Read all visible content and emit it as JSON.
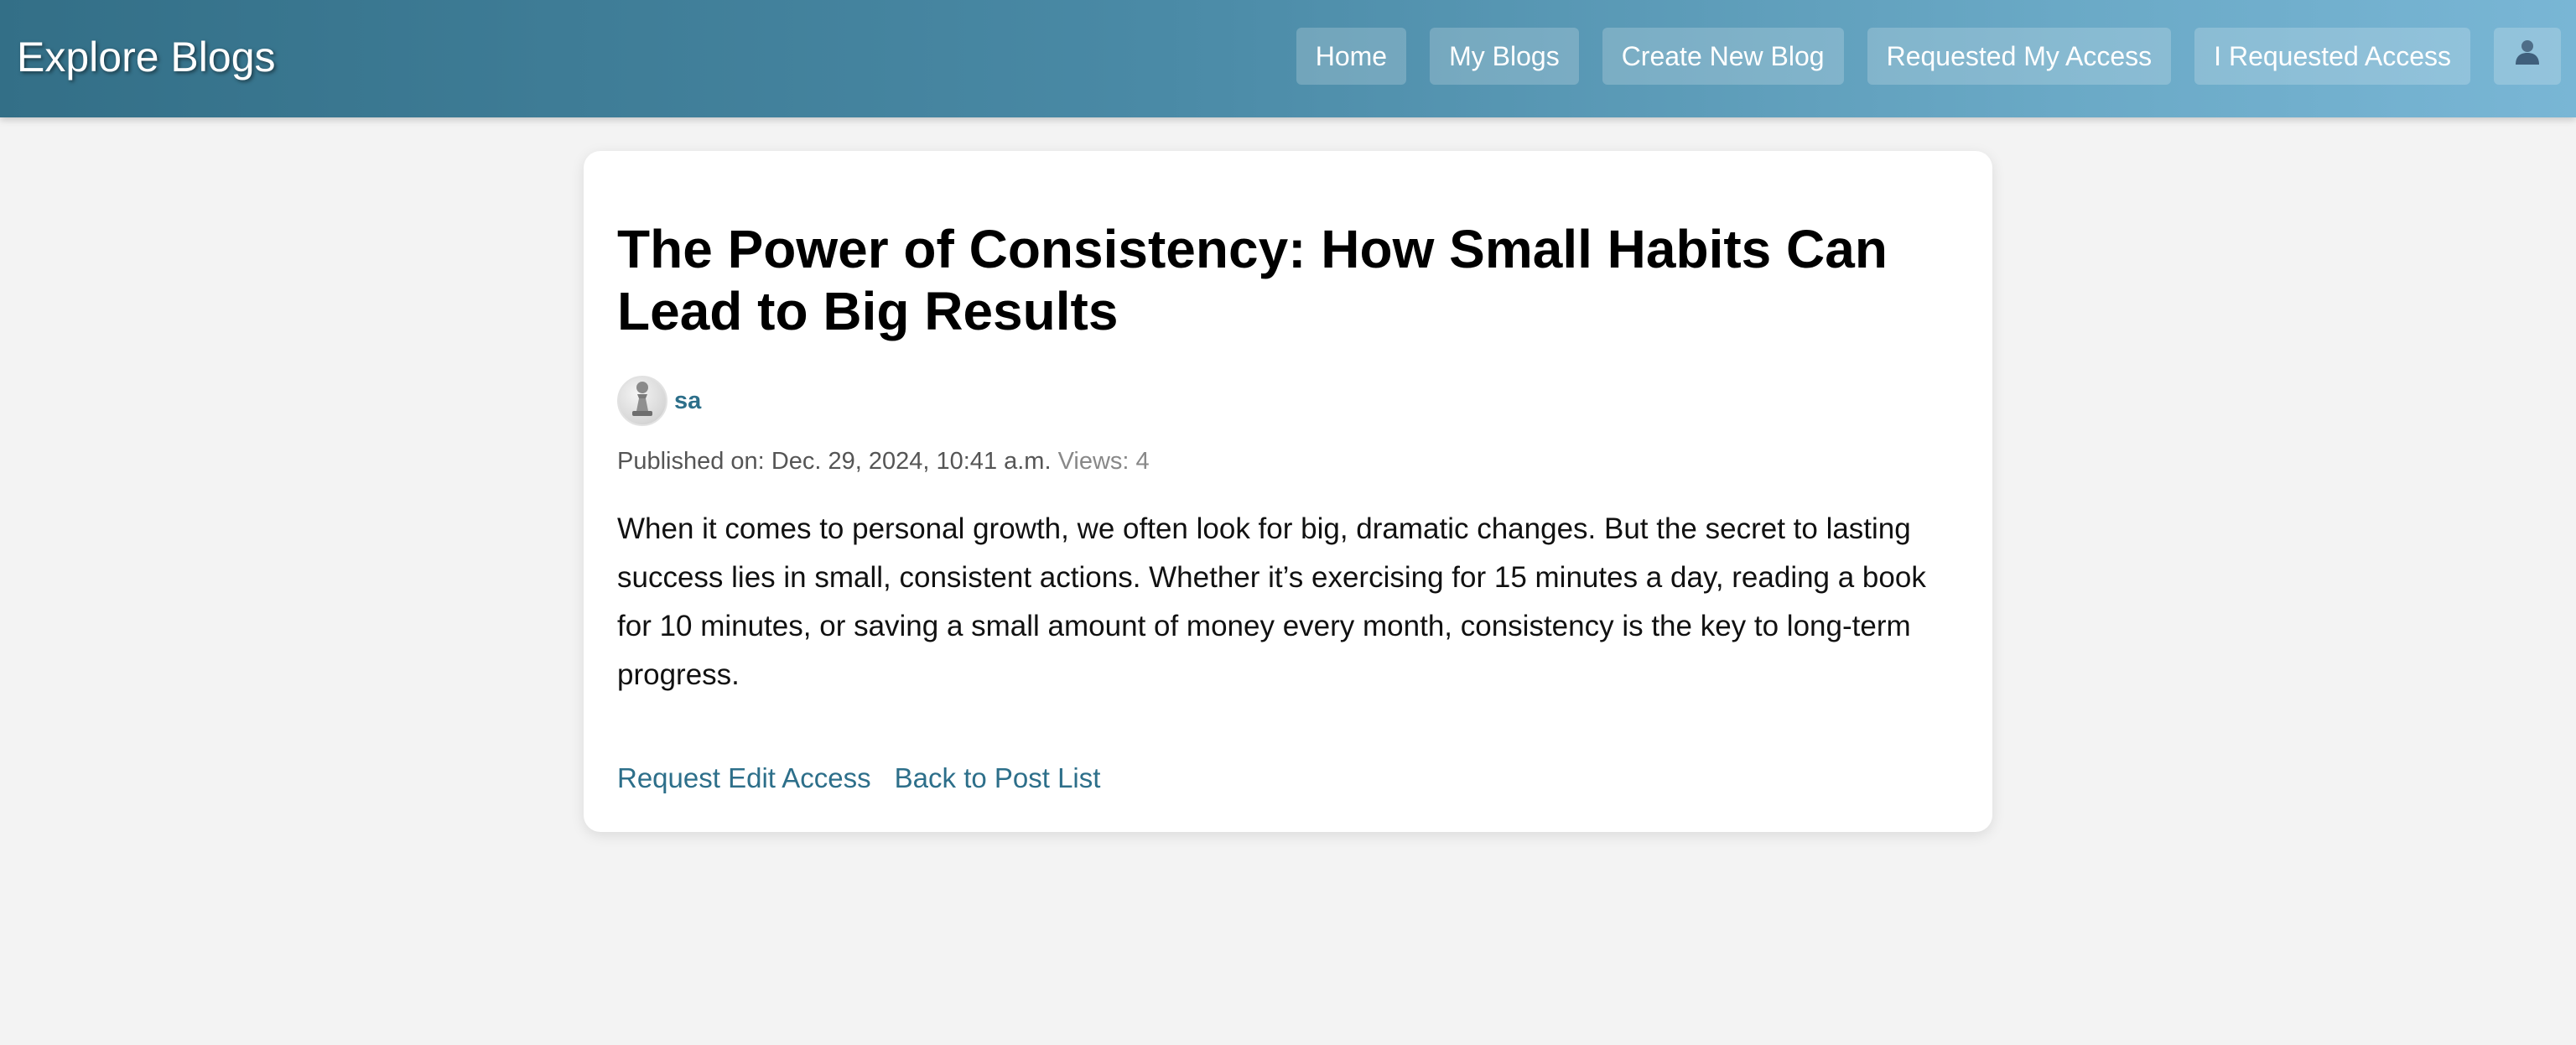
{
  "header": {
    "brand": "Explore Blogs",
    "nav": {
      "home": "Home",
      "my_blogs": "My Blogs",
      "create_new_blog": "Create New Blog",
      "requested_my_access": "Requested My Access",
      "i_requested_access": "I Requested Access"
    },
    "profile_icon": "user-icon"
  },
  "post": {
    "title": "The Power of Consistency: How Small Habits Can Lead to Big Results",
    "author": {
      "name": "sa",
      "avatar_icon": "chess-pawn-avatar"
    },
    "published_label": "Published on:",
    "published_date": "Dec. 29, 2024, 10:41 a.m.",
    "views": "Views: 4",
    "body": "When it comes to personal growth, we often look for big, dramatic changes. But the secret to lasting success lies in small, consistent actions. Whether it’s exercising for 15 minutes a day, reading a book for 10 minutes, or saving a small amount of money every month, consistency is the key to long-term progress.",
    "actions": {
      "request_edit_access": "Request Edit Access",
      "back_to_post_list": "Back to Post List"
    }
  },
  "colors": {
    "header_gradient_start": "#336f87",
    "header_gradient_end": "#79b6d5",
    "link": "#2d6f8a",
    "page_background": "#f3f3f3"
  }
}
